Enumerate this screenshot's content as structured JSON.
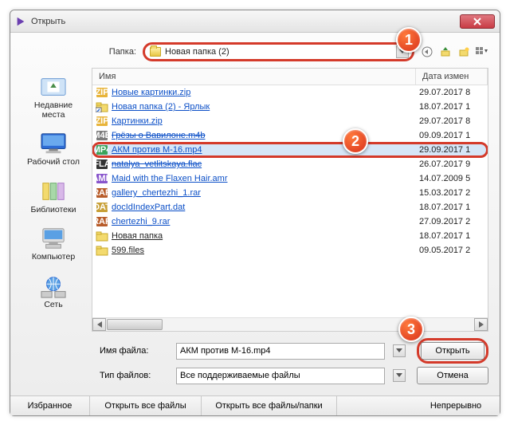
{
  "title": "Открыть",
  "folder": {
    "label": "Папка:",
    "value": "Новая папка (2)"
  },
  "tool_icons": [
    "back-icon",
    "up-icon",
    "new-folder-icon",
    "view-icon"
  ],
  "columns": {
    "name": "Имя",
    "date": "Дата измен"
  },
  "files": [
    {
      "icon": "zip",
      "name": "Новые картинки.zip",
      "date": "29.07.2017 8",
      "struck": false
    },
    {
      "icon": "shortcut",
      "name": "Новая папка (2) - Ярлык",
      "date": "18.07.2017 1",
      "struck": false
    },
    {
      "icon": "zip",
      "name": "Картинки.zip",
      "date": "29.07.2017 8",
      "struck": false
    },
    {
      "icon": "m4b",
      "name": "Грёзы о Вавилоне.m4b",
      "date": "09.09.2017 1",
      "struck": true
    },
    {
      "icon": "mp4",
      "name": "АКМ против М-16.mp4",
      "date": "29.09.2017 1",
      "struck": false,
      "selected": true
    },
    {
      "icon": "flac",
      "name": "natalya_vetlitskaya.flac",
      "date": "26.07.2017 9",
      "struck": true
    },
    {
      "icon": "amr",
      "name": "Maid with the Flaxen Hair.amr",
      "date": "14.07.2009 5",
      "struck": false
    },
    {
      "icon": "rar",
      "name": "gallery_chertezhi_1.rar",
      "date": "15.03.2017 2",
      "struck": false
    },
    {
      "icon": "dat",
      "name": "docIdIndexPart.dat",
      "date": "18.07.2017 1",
      "struck": false
    },
    {
      "icon": "rar",
      "name": "chertezhi_9.rar",
      "date": "27.09.2017 2",
      "struck": false
    },
    {
      "icon": "folder",
      "name": "Новая папка",
      "date": "18.07.2017 1",
      "struck": false
    },
    {
      "icon": "folder",
      "name": "599.files",
      "date": "09.05.2017 2",
      "struck": false
    }
  ],
  "places": [
    {
      "key": "recent",
      "label": "Недавние места"
    },
    {
      "key": "desktop",
      "label": "Рабочий стол"
    },
    {
      "key": "libraries",
      "label": "Библиотеки"
    },
    {
      "key": "computer",
      "label": "Компьютер"
    },
    {
      "key": "network",
      "label": "Сеть"
    }
  ],
  "filename": {
    "label": "Имя файла:",
    "value": "АКМ против М-16.mp4"
  },
  "filetype": {
    "label": "Тип файлов:",
    "value": "Все поддерживаемые файлы"
  },
  "buttons": {
    "open": "Открыть",
    "cancel": "Отмена"
  },
  "footer": {
    "favorites": "Избранное",
    "open_all_files": "Открыть все файлы",
    "open_all_files_folders": "Открыть все файлы/папки",
    "continuous": "Непрерывно"
  },
  "badges": {
    "b1": "1",
    "b2": "2",
    "b3": "3"
  }
}
